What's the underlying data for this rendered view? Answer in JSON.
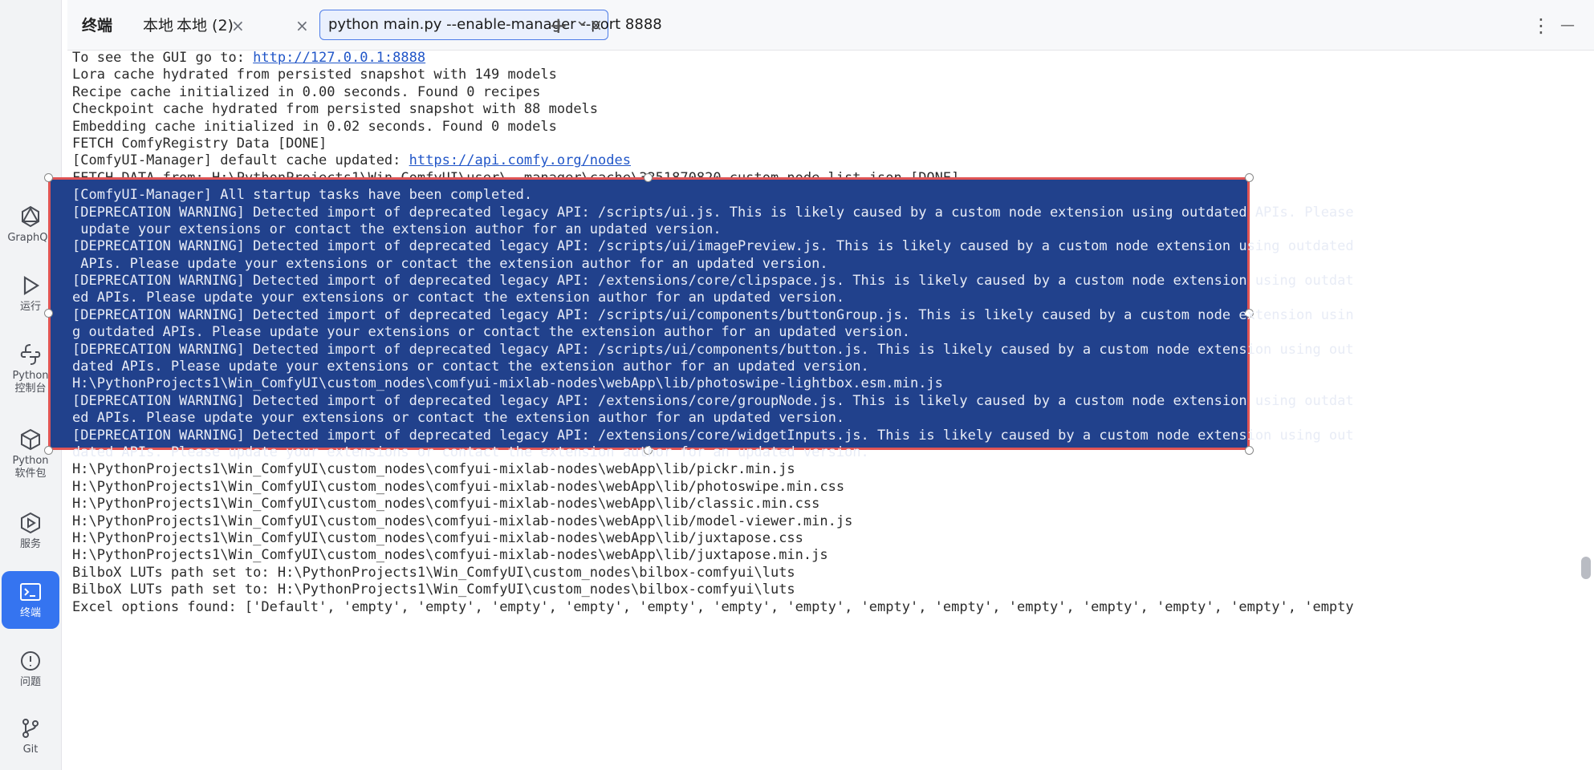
{
  "sidebar": {
    "items": [
      {
        "icon": "graphql-icon",
        "label": "GraphQL"
      },
      {
        "icon": "run-icon",
        "label": "运行"
      },
      {
        "icon": "python-console-icon",
        "label": "Python\n控制台"
      },
      {
        "icon": "python-packages-icon",
        "label": "Python\n软件包"
      },
      {
        "icon": "services-icon",
        "label": "服务"
      },
      {
        "icon": "terminal-icon",
        "label": "终端"
      },
      {
        "icon": "problems-icon",
        "label": "问题"
      },
      {
        "icon": "git-icon",
        "label": "Git"
      }
    ]
  },
  "tabbar": {
    "title": "终端",
    "tabs": [
      {
        "label": "本地"
      },
      {
        "label": "本地 (2)"
      },
      {
        "label": "python main.py --enable-manager --port 8888"
      }
    ],
    "close_glyph": "×",
    "add_glyph": "+",
    "dropdown_glyph": "⌄",
    "more_glyph": "⋮",
    "minimize_glyph": "—"
  },
  "terminal": {
    "lines": [
      {
        "text": "To see the GUI go to: ",
        "link": "http://127.0.0.1:8888",
        "sel": false
      },
      {
        "text": "Lora cache hydrated from persisted snapshot with 149 models",
        "sel": false
      },
      {
        "text": "Recipe cache initialized in 0.00 seconds. Found 0 recipes",
        "sel": false
      },
      {
        "text": "Checkpoint cache hydrated from persisted snapshot with 88 models",
        "sel": false
      },
      {
        "text": "Embedding cache initialized in 0.02 seconds. Found 0 models",
        "sel": false
      },
      {
        "text": "FETCH ComfyRegistry Data [DONE]",
        "sel": false
      },
      {
        "text": "[ComfyUI-Manager] default cache updated: ",
        "link": "https://api.comfy.org/nodes",
        "sel": false
      },
      {
        "text": "FETCH DATA from: H:\\PythonProjects1\\Win_ComfyUI\\user\\__manager\\cache\\3351870820_custom-node-list.json [DONE]",
        "sel": false
      },
      {
        "text": "[ComfyUI-Manager] All startup tasks have been completed.",
        "sel": true
      },
      {
        "text": "[DEPRECATION WARNING] Detected import of deprecated legacy API: /scripts/ui.js. This is likely caused by a custom node extension using outdated APIs. Please",
        "sel": true
      },
      {
        "text": " update your extensions or contact the extension author for an updated version.",
        "sel": true
      },
      {
        "text": "[DEPRECATION WARNING] Detected import of deprecated legacy API: /scripts/ui/imagePreview.js. This is likely caused by a custom node extension using outdated",
        "sel": true
      },
      {
        "text": " APIs. Please update your extensions or contact the extension author for an updated version.",
        "sel": true
      },
      {
        "text": "[DEPRECATION WARNING] Detected import of deprecated legacy API: /extensions/core/clipspace.js. This is likely caused by a custom node extension using outdat",
        "sel": true
      },
      {
        "text": "ed APIs. Please update your extensions or contact the extension author for an updated version.",
        "sel": true
      },
      {
        "text": "[DEPRECATION WARNING] Detected import of deprecated legacy API: /scripts/ui/components/buttonGroup.js. This is likely caused by a custom node extension usin",
        "sel": true
      },
      {
        "text": "g outdated APIs. Please update your extensions or contact the extension author for an updated version.",
        "sel": true
      },
      {
        "text": "[DEPRECATION WARNING] Detected import of deprecated legacy API: /scripts/ui/components/button.js. This is likely caused by a custom node extension using out",
        "sel": true
      },
      {
        "text": "dated APIs. Please update your extensions or contact the extension author for an updated version.",
        "sel": true
      },
      {
        "text": "H:\\PythonProjects1\\Win_ComfyUI\\custom_nodes\\comfyui-mixlab-nodes\\webApp\\lib/photoswipe-lightbox.esm.min.js",
        "sel": true
      },
      {
        "text": "[DEPRECATION WARNING] Detected import of deprecated legacy API: /extensions/core/groupNode.js. This is likely caused by a custom node extension using outdat",
        "sel": true
      },
      {
        "text": "ed APIs. Please update your extensions or contact the extension author for an updated version.",
        "sel": true
      },
      {
        "text": "[DEPRECATION WARNING] Detected import of deprecated legacy API: /extensions/core/widgetInputs.js. This is likely caused by a custom node extension using out",
        "sel": true
      },
      {
        "text": "dated APIs. Please update your extensions or contact the extension author for an updated version.",
        "sel": true
      },
      {
        "text": "H:\\PythonProjects1\\Win_ComfyUI\\custom_nodes\\comfyui-mixlab-nodes\\webApp\\lib/pickr.min.js",
        "sel": false
      },
      {
        "text": "H:\\PythonProjects1\\Win_ComfyUI\\custom_nodes\\comfyui-mixlab-nodes\\webApp\\lib/photoswipe.min.css",
        "sel": false
      },
      {
        "text": "H:\\PythonProjects1\\Win_ComfyUI\\custom_nodes\\comfyui-mixlab-nodes\\webApp\\lib/classic.min.css",
        "sel": false
      },
      {
        "text": "H:\\PythonProjects1\\Win_ComfyUI\\custom_nodes\\comfyui-mixlab-nodes\\webApp\\lib/model-viewer.min.js",
        "sel": false
      },
      {
        "text": "H:\\PythonProjects1\\Win_ComfyUI\\custom_nodes\\comfyui-mixlab-nodes\\webApp\\lib/juxtapose.css",
        "sel": false
      },
      {
        "text": "H:\\PythonProjects1\\Win_ComfyUI\\custom_nodes\\comfyui-mixlab-nodes\\webApp\\lib/juxtapose.min.js",
        "sel": false
      },
      {
        "text": "BilboX LUTs path set to: H:\\PythonProjects1\\Win_ComfyUI\\custom_nodes\\bilbox-comfyui\\luts",
        "sel": false
      },
      {
        "text": "BilboX LUTs path set to: H:\\PythonProjects1\\Win_ComfyUI\\custom_nodes\\bilbox-comfyui\\luts",
        "sel": false
      },
      {
        "text": "Excel options found: ['Default', 'empty', 'empty', 'empty', 'empty', 'empty', 'empty', 'empty', 'empty', 'empty', 'empty', 'empty', 'empty', 'empty', 'empty",
        "sel": false
      }
    ]
  },
  "colors": {
    "accent": "#3574f0",
    "selection": "#21418c",
    "selection_border": "#e05454",
    "link": "#2156c8"
  }
}
